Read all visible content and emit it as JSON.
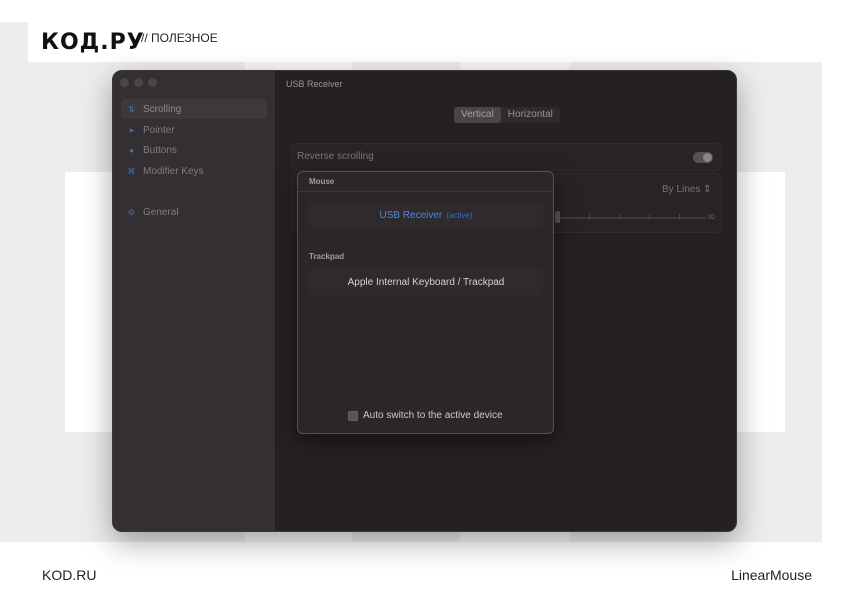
{
  "header": {
    "logo": "КОД.РУ",
    "tagline": "// ПОЛЕЗНОЕ"
  },
  "footer": {
    "left": "KOD.RU",
    "right": "LinearMouse"
  },
  "window": {
    "title": "USB Receiver",
    "sidebar": [
      {
        "label": "Scrolling",
        "icon": "scroll-arrows-icon",
        "glyph": "⇅",
        "active": true
      },
      {
        "label": "Pointer",
        "icon": "pointer-icon",
        "glyph": "➤",
        "active": false
      },
      {
        "label": "Buttons",
        "icon": "buttons-icon",
        "glyph": "●",
        "active": false
      },
      {
        "label": "Modifier Keys",
        "icon": "command-key-icon",
        "glyph": "⌘",
        "active": false
      },
      {
        "label": "General",
        "icon": "gear-icon",
        "glyph": "⚙",
        "active": false
      }
    ],
    "segment": {
      "options": [
        "Vertical",
        "Horizontal"
      ],
      "selected": "Vertical"
    },
    "reverse_scrolling": {
      "label": "Reverse scrolling",
      "on": true
    },
    "mode": {
      "value": "By Lines",
      "chevron": "⇕"
    },
    "slider": {
      "max_label": "10"
    }
  },
  "popover": {
    "mouse_section": "Mouse",
    "mouse_device": "USB Receiver",
    "active_tag": "(active)",
    "trackpad_section": "Trackpad",
    "trackpad_device": "Apple Internal Keyboard / Trackpad",
    "auto_switch_label": "Auto switch to the active device",
    "auto_switch_checked": false
  },
  "colors": {
    "accent": "#4f86e0",
    "window_bg": "#242023",
    "sidebar_bg": "#332f32"
  }
}
